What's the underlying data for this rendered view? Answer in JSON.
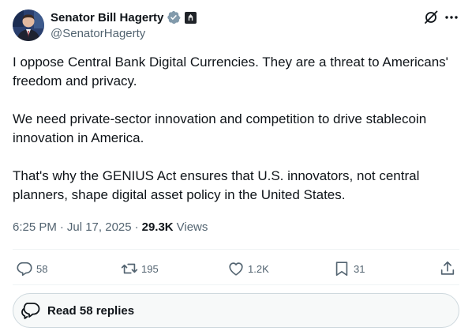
{
  "author": {
    "display_name": "Senator Bill Hagerty",
    "handle": "@SenatorHagerty"
  },
  "post": {
    "paragraphs": [
      "I oppose Central Bank Digital Currencies. They are a threat to Americans' freedom and privacy.",
      "We need private-sector innovation and competition to drive stablecoin innovation in America.",
      "That's why the GENIUS Act ensures that U.S. innovators, not central planners, shape digital asset policy in the United States."
    ],
    "time": "6:25 PM",
    "date": "Jul 17, 2025",
    "views_count": "29.3K",
    "views_label": "Views",
    "separator": "·"
  },
  "actions": {
    "replies": "58",
    "reposts": "195",
    "likes": "1.2K",
    "bookmarks": "31"
  },
  "replies_button": {
    "label": "Read 58 replies"
  },
  "colors": {
    "text": "#0f1419",
    "secondary": "#536471",
    "verified_badge": "#829aab",
    "divider": "#eff3f4"
  },
  "icons": {
    "verified": "verified-badge-icon",
    "gov": "government-badge-icon",
    "grok": "grok-icon",
    "more": "more-icon",
    "reply": "reply-icon",
    "repost": "repost-icon",
    "like": "heart-icon",
    "bookmark": "bookmark-icon",
    "share": "share-icon",
    "replies": "speech-bubbles-icon"
  }
}
